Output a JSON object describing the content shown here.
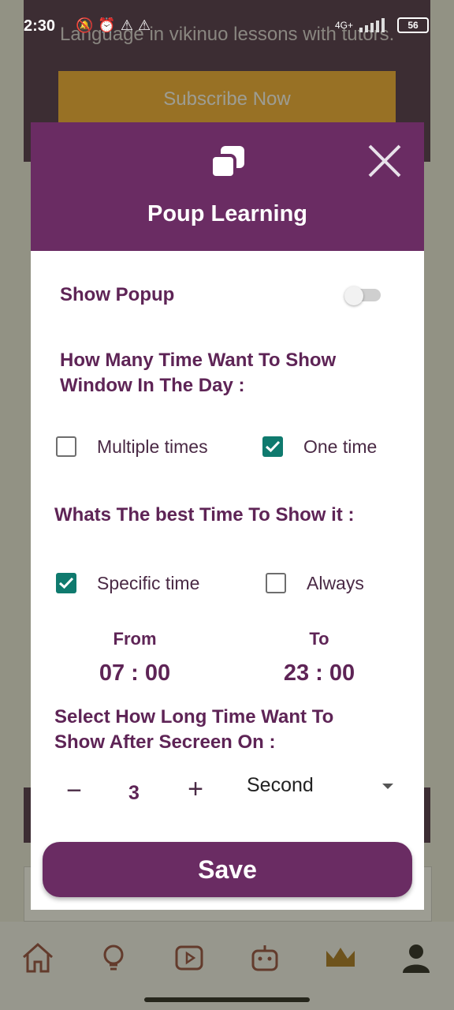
{
  "status_bar": {
    "time": "2:30",
    "battery": "56",
    "network": "4G+"
  },
  "background": {
    "banner_text": "Language in vikinuo lessons with tutors.",
    "subscribe_label": "Subscribe Now"
  },
  "modal": {
    "title": "Poup Learning",
    "show_popup_label": "Show Popup",
    "show_popup_on": false,
    "how_many_heading": "How Many Time Want To Show Window In The Day :",
    "frequency_options": [
      {
        "label": "Multiple times",
        "checked": false
      },
      {
        "label": "One time",
        "checked": true
      }
    ],
    "best_time_heading": "Whats The best Time To Show it :",
    "time_options": [
      {
        "label": "Specific time",
        "checked": true
      },
      {
        "label": "Always",
        "checked": false
      }
    ],
    "from_label": "From",
    "from_value": "07 : 00",
    "to_label": "To",
    "to_value": "23 : 00",
    "duration_heading": "Select How Long Time Want To Show After Secreen On :",
    "stepper_minus": "−",
    "stepper_value": "3",
    "stepper_plus": "+",
    "unit_selected": "Second",
    "save_label": "Save"
  },
  "colors": {
    "header_purple": "#6a2c63",
    "text_purple": "#5e2456",
    "checkbox_green": "#0f7a6e"
  },
  "icons": [
    "copy-icon",
    "close-icon",
    "home-icon",
    "lightbulb-icon",
    "video-icon",
    "robot-icon",
    "crown-icon",
    "profile-icon"
  ]
}
